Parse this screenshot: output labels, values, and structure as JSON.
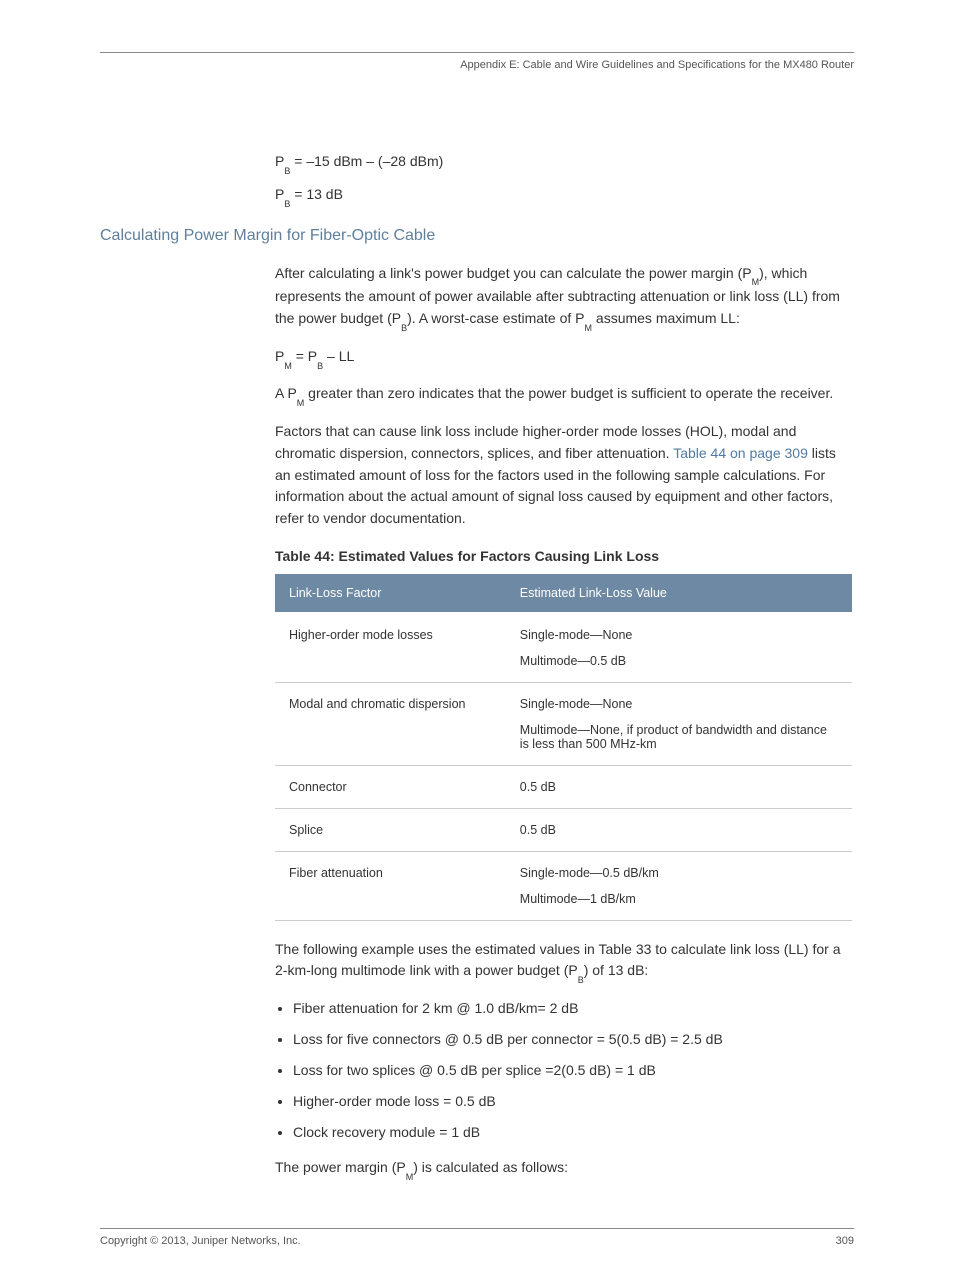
{
  "header": {
    "running_head": "Appendix E: Cable and Wire Guidelines and Specifications for the MX480 Router"
  },
  "equations_top": {
    "line1_pre": "P",
    "line1_sub": "B",
    "line1_post": " = –15 dBm – (–28 dBm)",
    "line2_pre": "P",
    "line2_sub": "B",
    "line2_post": " = 13 dB"
  },
  "section": {
    "title": "Calculating Power Margin for Fiber-Optic Cable",
    "para1_a": "After calculating a link's power budget you can calculate the power margin (P",
    "para1_sub1": "M",
    "para1_b": "), which represents the amount of power available after subtracting attenuation or link loss (LL) from the power budget (P",
    "para1_sub2": "B",
    "para1_c": "). A worst-case estimate of P",
    "para1_sub3": "M",
    "para1_d": " assumes maximum LL:",
    "eq_pre": "P",
    "eq_sub1": "M",
    "eq_mid": " = P",
    "eq_sub2": "B",
    "eq_post": " – LL",
    "para2_a": "A P",
    "para2_sub": "M",
    "para2_b": " greater than zero indicates that the power budget is sufficient to operate the receiver.",
    "para3_a": "Factors that can cause link loss include higher-order mode losses (HOL), modal and chromatic dispersion, connectors, splices, and fiber attenuation. ",
    "para3_link": "Table 44 on page 309",
    "para3_b": " lists an estimated amount of loss for the factors used in the following sample calculations. For information about the actual amount of signal loss caused by equipment and other factors, refer to vendor documentation."
  },
  "table": {
    "title": "Table 44: Estimated Values for Factors Causing Link Loss",
    "col1": "Link-Loss Factor",
    "col2": "Estimated Link-Loss Value",
    "rows": [
      {
        "factor": "Higher-order mode losses",
        "values": [
          "Single-mode—None",
          "Multimode—0.5 dB"
        ]
      },
      {
        "factor": "Modal and chromatic dispersion",
        "values": [
          "Single-mode—None",
          "Multimode—None, if product of bandwidth and distance is less than 500 MHz-km"
        ]
      },
      {
        "factor": "Connector",
        "values": [
          "0.5 dB"
        ]
      },
      {
        "factor": "Splice",
        "values": [
          "0.5 dB"
        ]
      },
      {
        "factor": "Fiber attenuation",
        "values": [
          "Single-mode—0.5 dB/km",
          "Multimode—1 dB/km"
        ]
      }
    ]
  },
  "after_table": {
    "para_a": "The following example uses the estimated values in Table 33 to calculate link loss (LL) for a 2-km-long multimode link with a power budget (P",
    "para_sub": "B",
    "para_b": ") of 13 dB:",
    "bullets": [
      "Fiber attenuation for 2 km @ 1.0 dB/km= 2 dB",
      "Loss for five connectors @ 0.5 dB per connector = 5(0.5 dB) = 2.5 dB",
      "Loss for two splices @ 0.5 dB per splice =2(0.5 dB) = 1 dB",
      "Higher-order mode loss = 0.5 dB",
      "Clock recovery module = 1 dB"
    ],
    "closing_a": "The power margin (P",
    "closing_sub": "M",
    "closing_b": ") is calculated as follows:"
  },
  "footer": {
    "left": "Copyright © 2013, Juniper Networks, Inc.",
    "right": "309"
  }
}
